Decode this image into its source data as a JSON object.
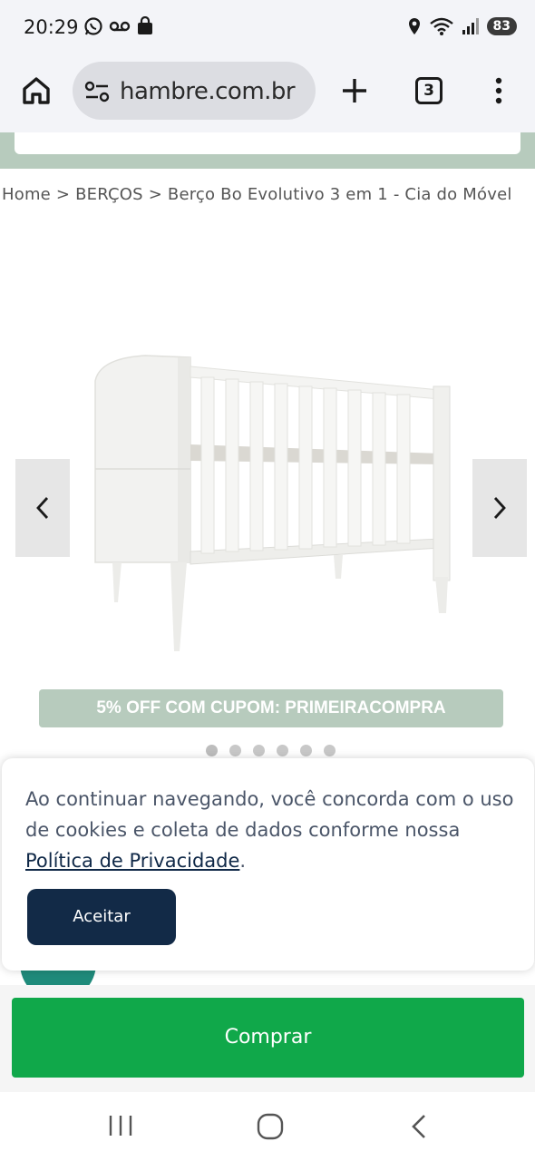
{
  "status_bar": {
    "time": "20:29",
    "battery": "83",
    "icons_left": [
      "whatsapp-icon",
      "voicemail-icon",
      "shopping-bag-icon"
    ],
    "icons_right": [
      "location-icon",
      "wifi-icon",
      "signal-icon",
      "battery-icon"
    ]
  },
  "browser": {
    "url": "hambre.com.br",
    "tab_count": "3",
    "icons": [
      "home-icon",
      "site-settings-icon",
      "plus-icon",
      "tabs-icon",
      "more-vert-icon"
    ]
  },
  "breadcrumb": {
    "text": "Home > BERÇOS > Berço Bo Evolutivo 3 em 1 - Cia do Móvel"
  },
  "product": {
    "image": "crib-image",
    "carousel": {
      "dot_count": 6,
      "active_index": 0
    }
  },
  "coupon": {
    "text": "5% OFF COM CUPOM: PRIMEIRACOMPRA"
  },
  "cookie": {
    "message": "Ao continuar navegando, você concorda com o uso de cookies e coleta de dados conforme nossa",
    "link_text": "Política de Privacidade",
    "suffix": ".",
    "accept_label": "Aceitar"
  },
  "buy": {
    "label": "Comprar"
  },
  "colors": {
    "brand_green": "#b7cbbd",
    "buy_green": "#10a84a",
    "accept_navy": "#122a47",
    "teal": "#1f8b7b"
  }
}
